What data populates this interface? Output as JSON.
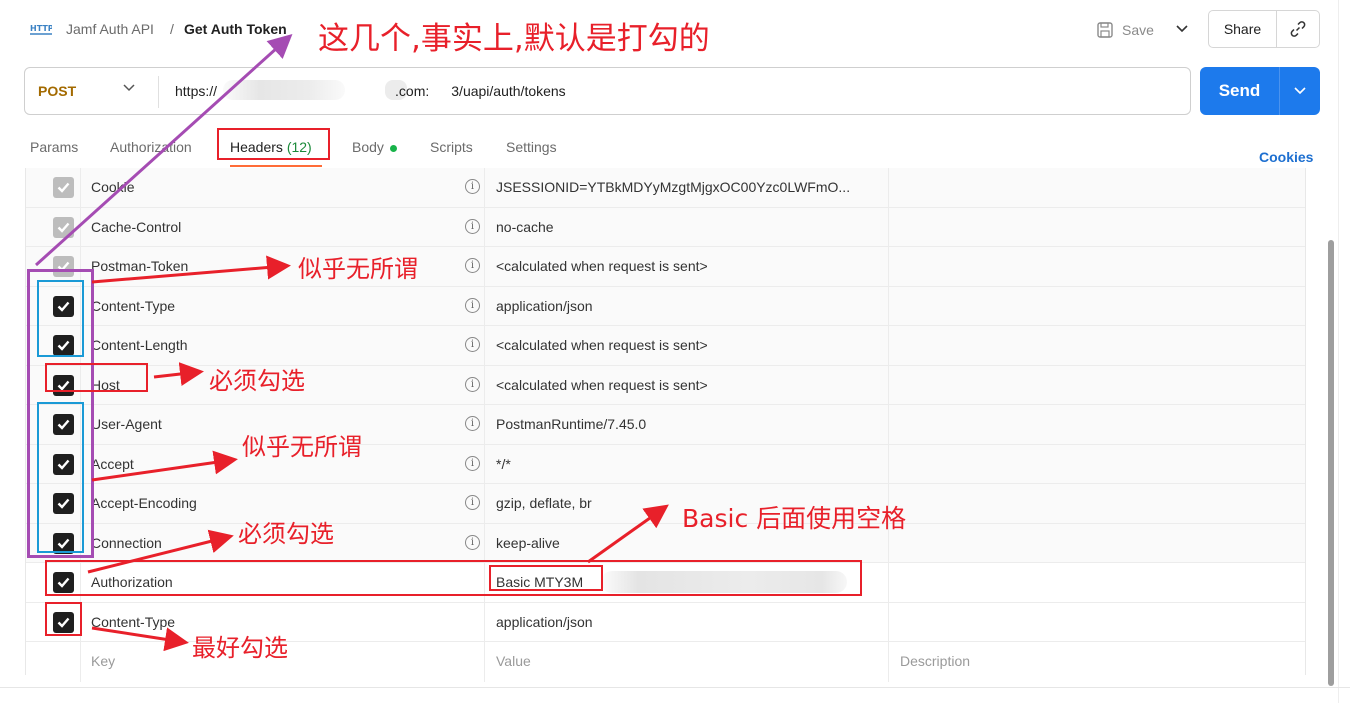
{
  "header": {
    "breadcrumb_parent": "Jamf Auth API",
    "breadcrumb_sep": "/",
    "title": "Get Auth Token",
    "save_label": "Save",
    "share_label": "Share"
  },
  "request": {
    "method": "POST",
    "url_prefix": "https://",
    "url_mid": ".com:",
    "url_suffix": "3/uapi/auth/tokens",
    "send_label": "Send"
  },
  "tabs": [
    {
      "label": "Params"
    },
    {
      "label": "Authorization"
    },
    {
      "label": "Headers",
      "count": "(12)"
    },
    {
      "label": "Body"
    },
    {
      "label": "Scripts"
    },
    {
      "label": "Settings"
    }
  ],
  "cookies_label": "Cookies",
  "headers_table": {
    "rows": [
      {
        "key": "Cookie",
        "value": "JSESSIONID=YTBkMDYyMzgtMjgxOC00Yzc0LWFmO..."
      },
      {
        "key": "Cache-Control",
        "value": "no-cache"
      },
      {
        "key": "Postman-Token",
        "value": "<calculated when request is sent>"
      },
      {
        "key": "Content-Type",
        "value": "application/json"
      },
      {
        "key": "Content-Length",
        "value": "<calculated when request is sent>"
      },
      {
        "key": "Host",
        "value": "<calculated when request is sent>"
      },
      {
        "key": "User-Agent",
        "value": "PostmanRuntime/7.45.0"
      },
      {
        "key": "Accept",
        "value": "*/*"
      },
      {
        "key": "Accept-Encoding",
        "value": "gzip, deflate, br"
      },
      {
        "key": "Connection",
        "value": "keep-alive"
      },
      {
        "key": "Authorization",
        "value": "Basic MTY3M"
      },
      {
        "key": "Content-Type",
        "value": "application/json"
      }
    ],
    "placeholder": {
      "key": "Key",
      "value": "Value",
      "description": "Description"
    }
  },
  "annotations": {
    "top": "这几个,事实上,默认是打勾的",
    "postman_token": "似乎无所谓",
    "host": "必须勾选",
    "accept": "似乎无所谓",
    "connection": "必须勾选",
    "basic": "Basic 后面使用空格",
    "content_type": "最好勾选"
  },
  "colors": {
    "send": "#1d7aec",
    "method": "#a36a00",
    "annotation_red": "#e8202a",
    "annotation_blue": "#1a9ad6",
    "annotation_purple": "#a54cb3",
    "tab_underline": "#ff6c37"
  }
}
